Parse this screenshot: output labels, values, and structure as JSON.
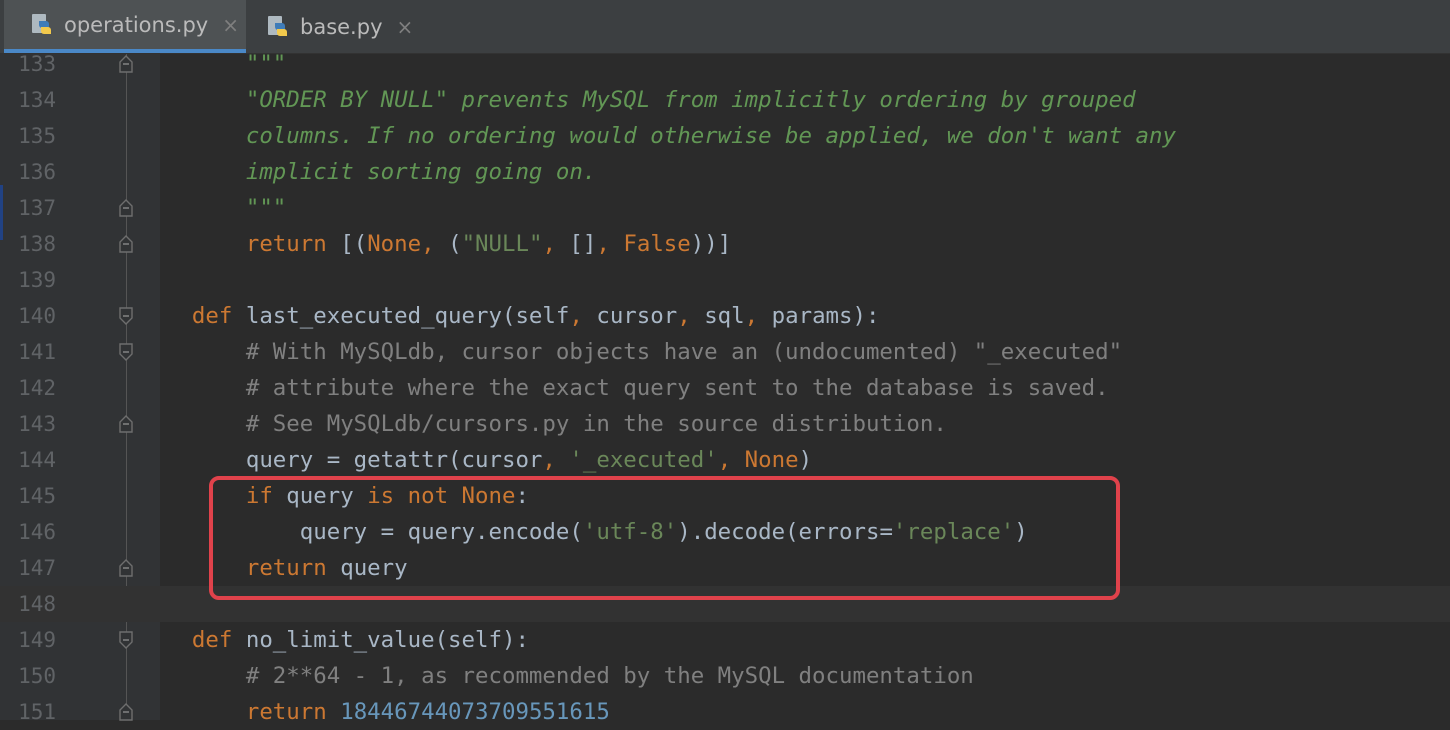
{
  "tabs": [
    {
      "label": "operations.py",
      "active": true
    },
    {
      "label": "base.py",
      "active": false
    }
  ],
  "close_glyph": "×",
  "lines": [
    {
      "num": "133",
      "fold": "marker",
      "tokens": [
        {
          "t": "        ",
          "c": ""
        },
        {
          "t": "\"\"\"",
          "c": "doc"
        }
      ]
    },
    {
      "num": "134",
      "fold": "",
      "tokens": [
        {
          "t": "        ",
          "c": ""
        },
        {
          "t": "\"ORDER BY NULL\" prevents MySQL from implicitly ordering by grouped",
          "c": "doc"
        }
      ]
    },
    {
      "num": "135",
      "fold": "",
      "tokens": [
        {
          "t": "        ",
          "c": ""
        },
        {
          "t": "columns. If no ordering would otherwise be applied, we don't want any",
          "c": "doc"
        }
      ]
    },
    {
      "num": "136",
      "fold": "",
      "tokens": [
        {
          "t": "        ",
          "c": ""
        },
        {
          "t": "implicit sorting going on.",
          "c": "doc"
        }
      ]
    },
    {
      "num": "137",
      "fold": "end",
      "tokens": [
        {
          "t": "        ",
          "c": ""
        },
        {
          "t": "\"\"\"",
          "c": "doc"
        }
      ]
    },
    {
      "num": "138",
      "fold": "end",
      "tokens": [
        {
          "t": "        ",
          "c": ""
        },
        {
          "t": "return ",
          "c": "kw"
        },
        {
          "t": "[(",
          "c": ""
        },
        {
          "t": "None",
          "c": "kw"
        },
        {
          "t": ", ",
          "c": "kw"
        },
        {
          "t": "(",
          "c": ""
        },
        {
          "t": "\"NULL\"",
          "c": "str"
        },
        {
          "t": ", ",
          "c": "kw"
        },
        {
          "t": "[]",
          "c": ""
        },
        {
          "t": ", ",
          "c": "kw"
        },
        {
          "t": "False",
          "c": "kw"
        },
        {
          "t": "))]",
          "c": ""
        }
      ]
    },
    {
      "num": "139",
      "fold": "",
      "tokens": []
    },
    {
      "num": "140",
      "fold": "start",
      "tokens": [
        {
          "t": "    ",
          "c": ""
        },
        {
          "t": "def ",
          "c": "kw"
        },
        {
          "t": "last_executed_query(self",
          "c": ""
        },
        {
          "t": ", ",
          "c": "kw"
        },
        {
          "t": "cursor",
          "c": ""
        },
        {
          "t": ", ",
          "c": "kw"
        },
        {
          "t": "sql",
          "c": ""
        },
        {
          "t": ", ",
          "c": "kw"
        },
        {
          "t": "params):",
          "c": ""
        }
      ]
    },
    {
      "num": "141",
      "fold": "start",
      "tokens": [
        {
          "t": "        ",
          "c": ""
        },
        {
          "t": "# With MySQLdb, cursor objects have an (undocumented) \"_executed\"",
          "c": "cm"
        }
      ]
    },
    {
      "num": "142",
      "fold": "",
      "tokens": [
        {
          "t": "        ",
          "c": ""
        },
        {
          "t": "# attribute where the exact query sent to the database is saved.",
          "c": "cm"
        }
      ]
    },
    {
      "num": "143",
      "fold": "end",
      "tokens": [
        {
          "t": "        ",
          "c": ""
        },
        {
          "t": "# See MySQLdb/cursors.py in the source distribution.",
          "c": "cm"
        }
      ]
    },
    {
      "num": "144",
      "fold": "",
      "tokens": [
        {
          "t": "        ",
          "c": ""
        },
        {
          "t": "query = getattr(cursor",
          "c": ""
        },
        {
          "t": ", ",
          "c": "kw"
        },
        {
          "t": "'_executed'",
          "c": "str"
        },
        {
          "t": ", ",
          "c": "kw"
        },
        {
          "t": "None",
          "c": "kw"
        },
        {
          "t": ")",
          "c": ""
        }
      ]
    },
    {
      "num": "145",
      "fold": "",
      "tokens": [
        {
          "t": "        ",
          "c": ""
        },
        {
          "t": "if ",
          "c": "kw"
        },
        {
          "t": "query ",
          "c": ""
        },
        {
          "t": "is not None",
          "c": "kw"
        },
        {
          "t": ":",
          "c": ""
        }
      ]
    },
    {
      "num": "146",
      "fold": "",
      "tokens": [
        {
          "t": "            ",
          "c": ""
        },
        {
          "t": "query = query.encode(",
          "c": ""
        },
        {
          "t": "'utf-8'",
          "c": "str"
        },
        {
          "t": ").decode(errors=",
          "c": ""
        },
        {
          "t": "'replace'",
          "c": "str"
        },
        {
          "t": ")",
          "c": ""
        }
      ]
    },
    {
      "num": "147",
      "fold": "end",
      "tokens": [
        {
          "t": "        ",
          "c": ""
        },
        {
          "t": "return ",
          "c": "kw"
        },
        {
          "t": "query",
          "c": ""
        }
      ]
    },
    {
      "num": "148",
      "fold": "",
      "current": true,
      "tokens": []
    },
    {
      "num": "149",
      "fold": "start",
      "tokens": [
        {
          "t": "    ",
          "c": ""
        },
        {
          "t": "def ",
          "c": "kw"
        },
        {
          "t": "no_limit_value(self):",
          "c": ""
        }
      ]
    },
    {
      "num": "150",
      "fold": "",
      "tokens": [
        {
          "t": "        ",
          "c": ""
        },
        {
          "t": "# 2**64 - 1, as recommended by the MySQL documentation",
          "c": "cm"
        }
      ]
    },
    {
      "num": "151",
      "fold": "end",
      "tokens": [
        {
          "t": "        ",
          "c": ""
        },
        {
          "t": "return ",
          "c": "kw"
        },
        {
          "t": "18446744073709551615",
          "c": "num-lit"
        }
      ]
    }
  ],
  "colors": {
    "background": "#2b2b2b",
    "keyword": "#cc7832",
    "string": "#6a8759",
    "docstring": "#629755",
    "comment": "#808080",
    "number": "#6897bb",
    "highlight_box": "#e0424b"
  }
}
